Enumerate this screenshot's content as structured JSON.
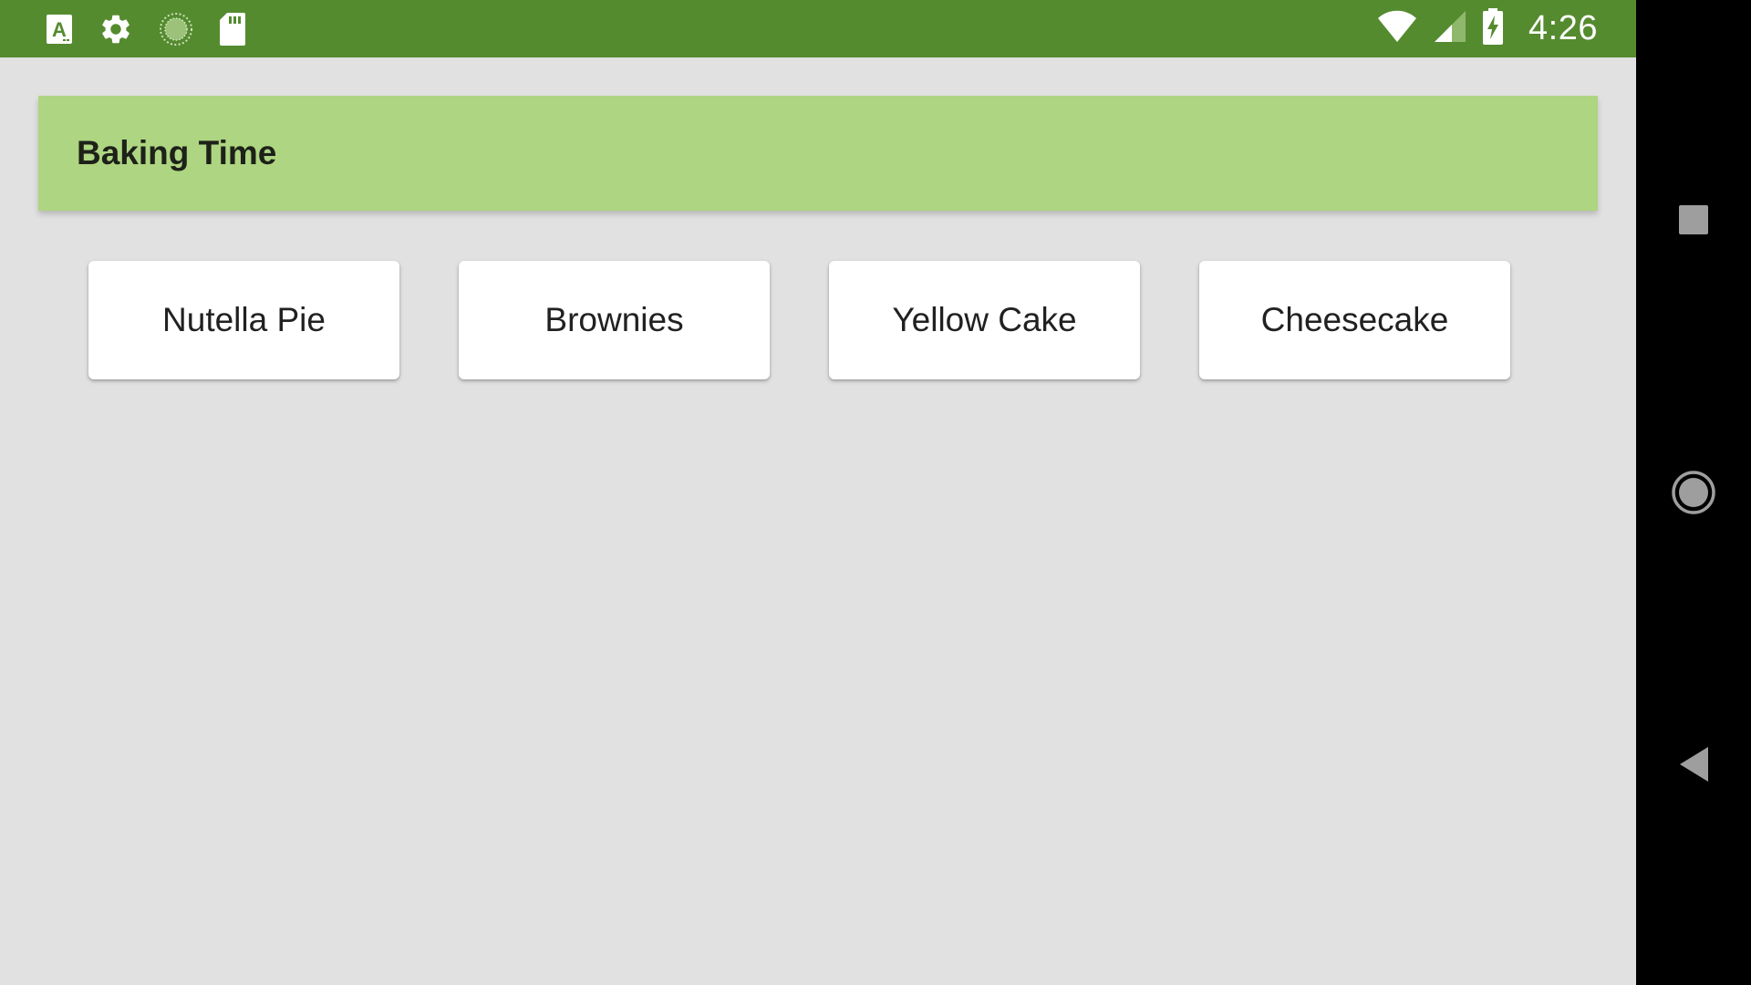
{
  "status_bar": {
    "time": "4:26",
    "color": "#548b2f",
    "left_icons": [
      "text-a-icon",
      "gear-icon",
      "sync-progress-icon",
      "sd-card-icon"
    ],
    "right_icons": [
      "wifi-icon",
      "cell-signal-icon",
      "battery-charging-icon"
    ]
  },
  "app_bar": {
    "title": "Baking Time",
    "color": "#aed581"
  },
  "recipes": [
    {
      "name": "Nutella Pie"
    },
    {
      "name": "Brownies"
    },
    {
      "name": "Yellow Cake"
    },
    {
      "name": "Cheesecake"
    }
  ],
  "nav_bar": {
    "buttons": [
      "recents-square-icon",
      "home-circle-icon",
      "back-triangle-icon"
    ]
  }
}
